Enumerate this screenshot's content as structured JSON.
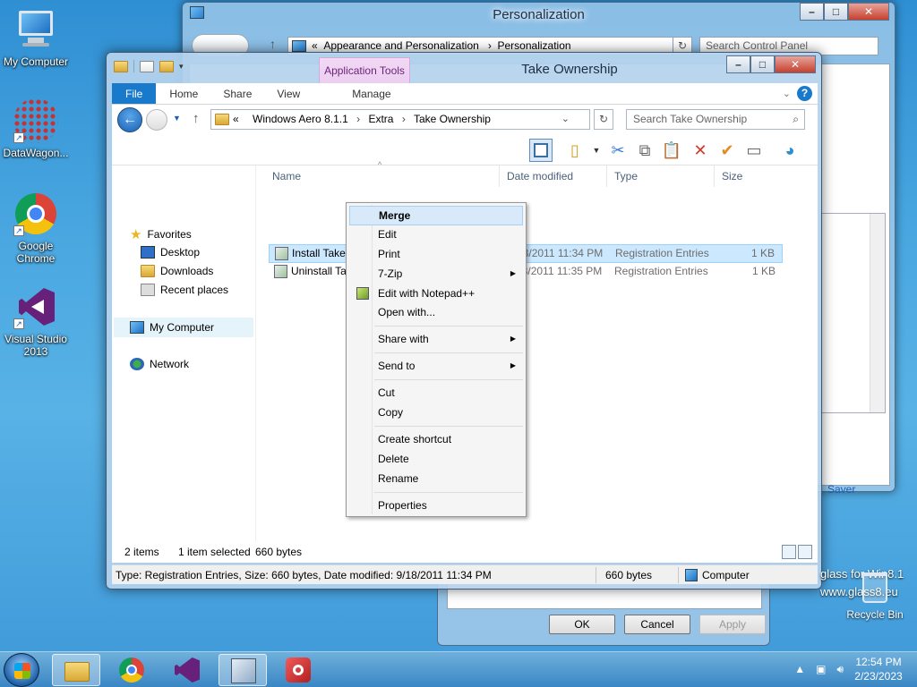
{
  "desktop": {
    "icons": [
      {
        "label": "My Computer"
      },
      {
        "label": "DataWagon..."
      },
      {
        "label": "Google Chrome"
      },
      {
        "label": "Visual Studio 2013"
      }
    ],
    "recycle_bin": "Recycle Bin",
    "glass_line1": "glass for Win8.1",
    "glass_line2": "www.glass8.eu"
  },
  "personalization": {
    "title": "Personalization",
    "breadcrumb": [
      "Appearance and Personalization",
      "Personalization"
    ],
    "search_placeholder": "Search Control Panel",
    "saver_label": "Saver",
    "buttons": {
      "ok": "OK",
      "cancel": "Cancel",
      "apply": "Apply"
    }
  },
  "explorer": {
    "title": "Take Ownership",
    "app_tools_label": "Application Tools",
    "tabs": [
      "File",
      "Home",
      "Share",
      "View"
    ],
    "manage_tab": "Manage",
    "breadcrumb": [
      "Windows Aero 8.1.1",
      "Extra",
      "Take Ownership"
    ],
    "search_placeholder": "Search Take Ownership",
    "nav": {
      "favorites": "Favorites",
      "desktop": "Desktop",
      "downloads": "Downloads",
      "recent": "Recent places",
      "my_computer": "My Computer",
      "network": "Network"
    },
    "columns": {
      "name": "Name",
      "date": "Date modified",
      "type": "Type",
      "size": "Size"
    },
    "files": [
      {
        "name": "Install Take Ownership",
        "date": "9/18/2011 11:34 PM",
        "type": "Registration Entries",
        "size": "1 KB"
      },
      {
        "name": "Uninstall Take Ownership",
        "date": "9/18/2011 11:35 PM",
        "type": "Registration Entries",
        "size": "1 KB"
      }
    ],
    "status": {
      "items": "2 items",
      "selected": "1 item selected",
      "bytes": "660 bytes",
      "details": "Type: Registration Entries, Size: 660 bytes, Date modified: 9/18/2011 11:34 PM",
      "size2": "660 bytes",
      "location": "Computer"
    }
  },
  "context_menu": {
    "merge": "Merge",
    "edit": "Edit",
    "print": "Print",
    "zip": "7-Zip",
    "notepad": "Edit with Notepad++",
    "open_with": "Open with...",
    "share_with": "Share with",
    "send_to": "Send to",
    "cut": "Cut",
    "copy": "Copy",
    "create_shortcut": "Create shortcut",
    "delete": "Delete",
    "rename": "Rename",
    "properties": "Properties"
  },
  "taskbar": {
    "time": "12:54 PM",
    "date": "2/23/2023"
  }
}
